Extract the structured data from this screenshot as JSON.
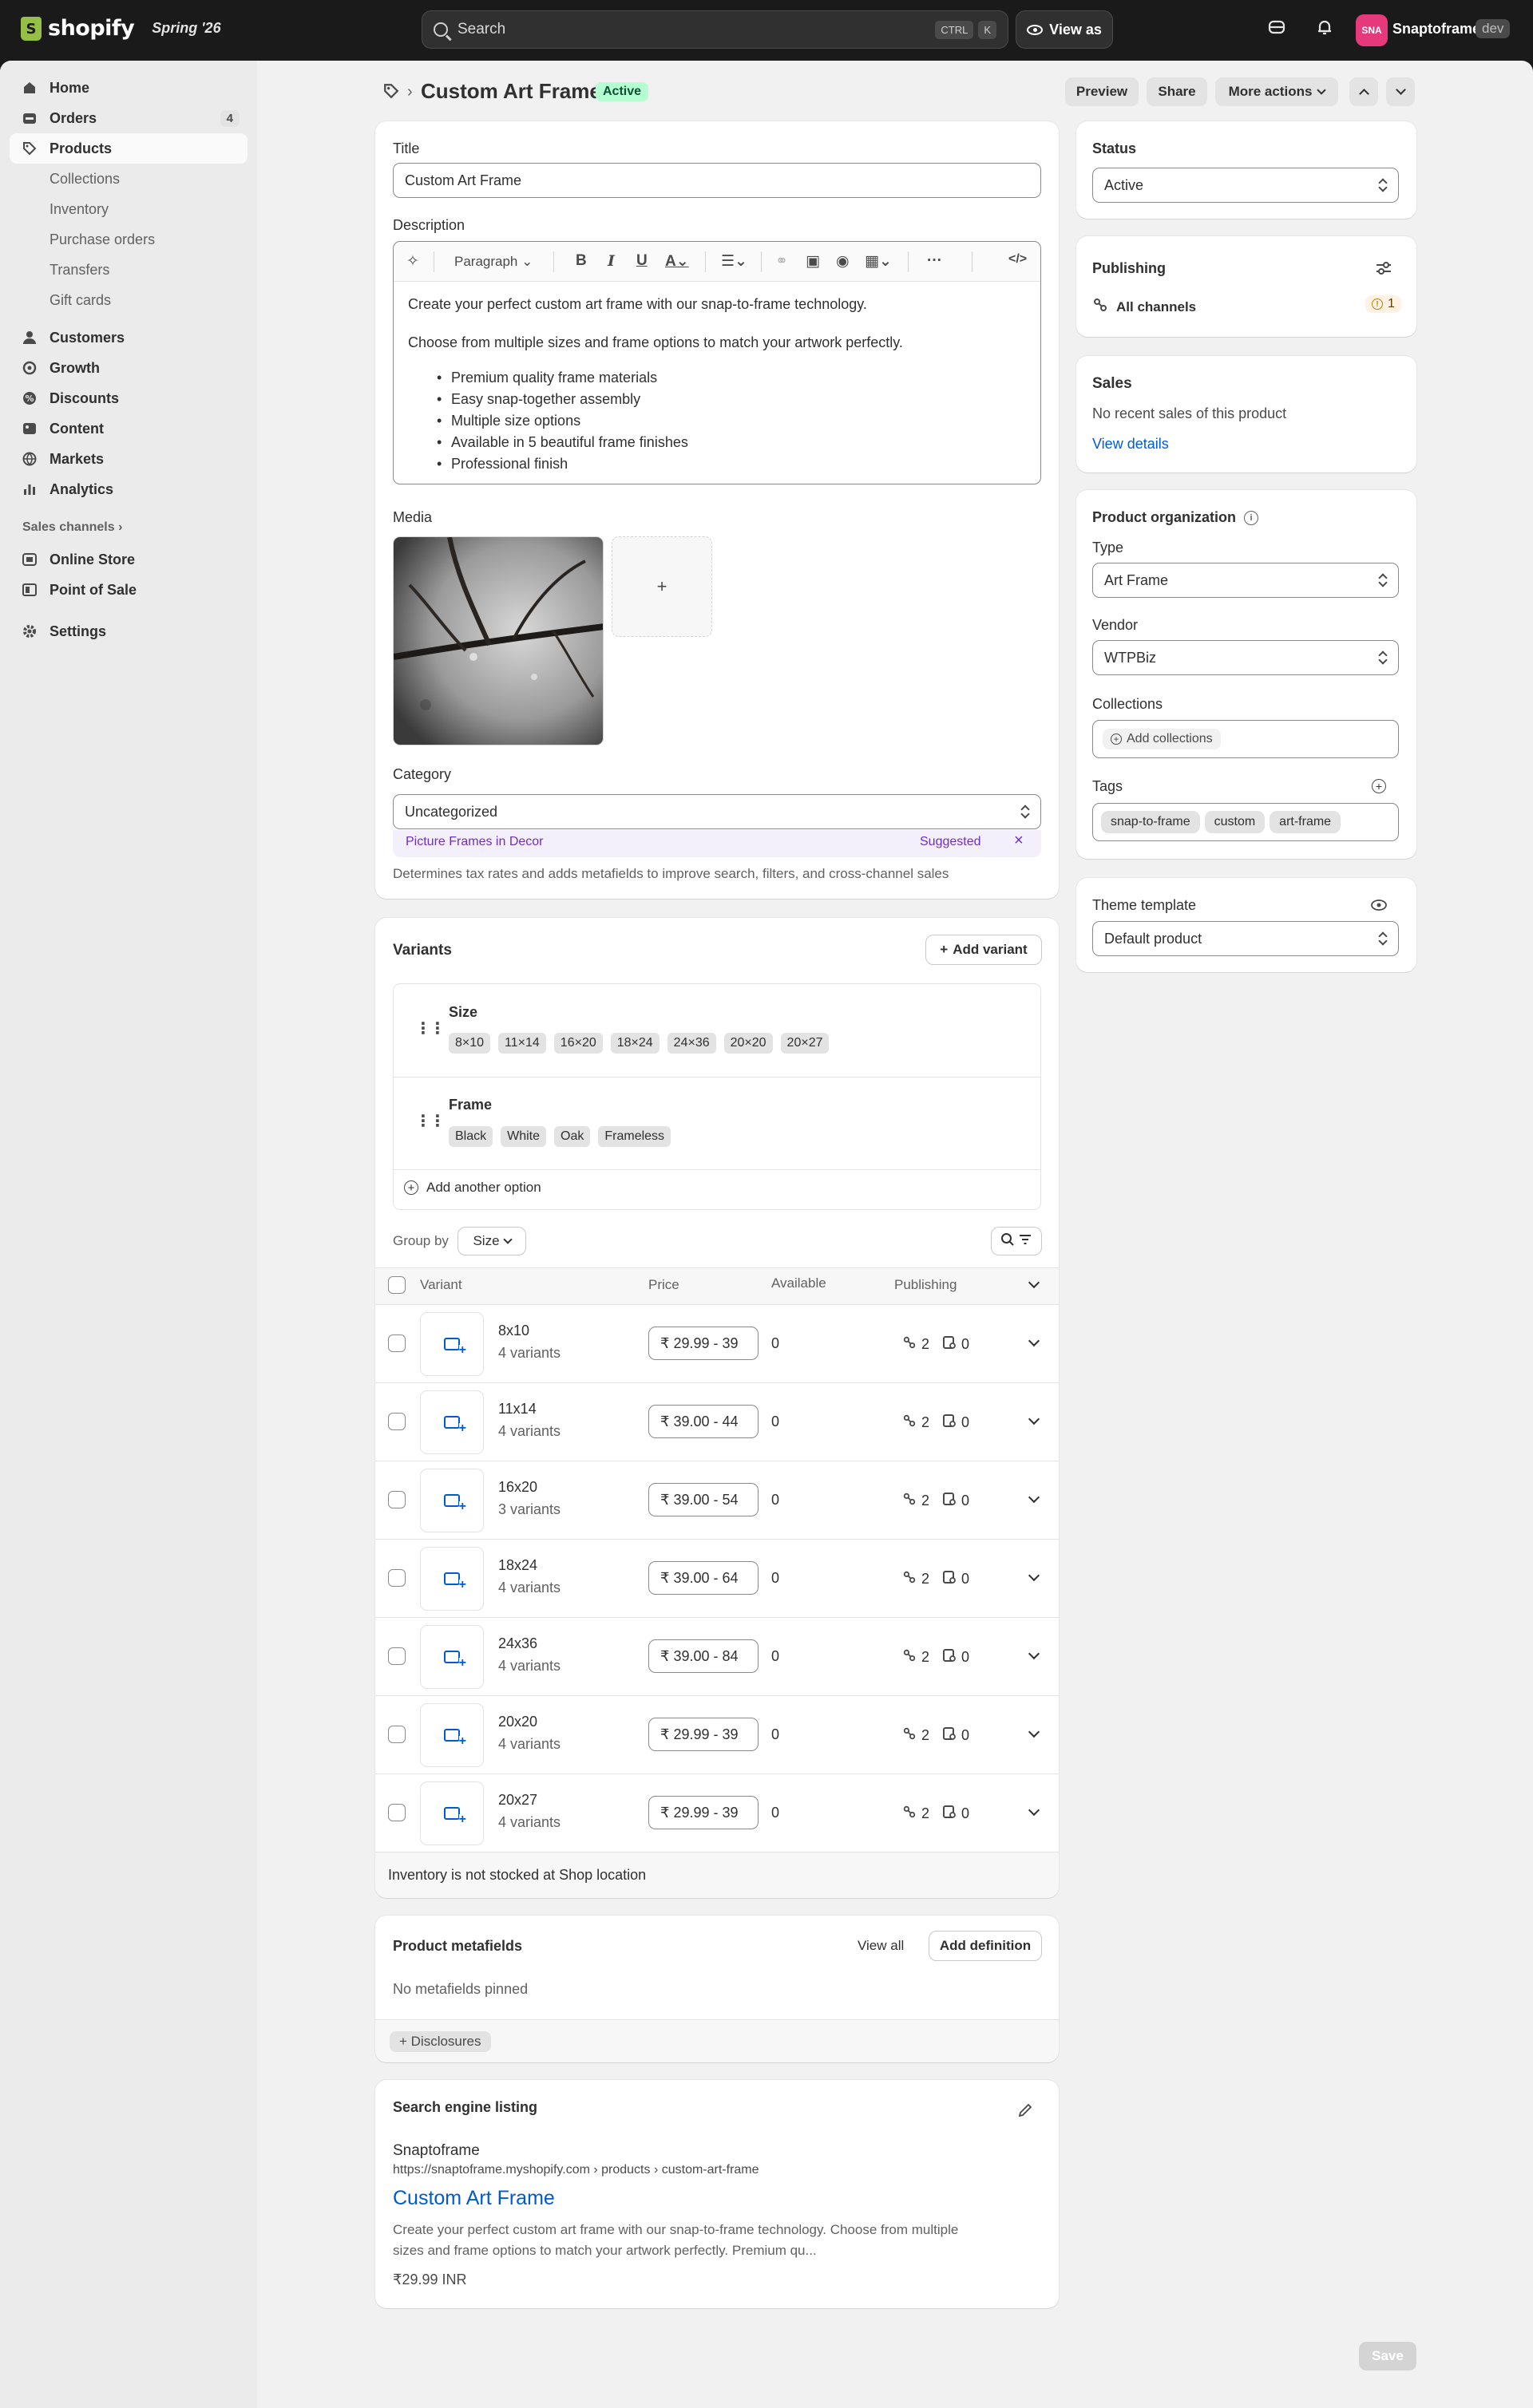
{
  "topbar": {
    "logo_text": "shopify",
    "edition": "Spring '26",
    "search_placeholder": "Search",
    "shortcut_keys": [
      "CTRL",
      "K"
    ],
    "view_as": "View as",
    "store_initials": "SNA",
    "store_name": "Snaptoframe",
    "store_badge": "dev"
  },
  "sidebar": {
    "items": [
      {
        "label": "Home",
        "icon": "home-icon"
      },
      {
        "label": "Orders",
        "icon": "orders-icon",
        "count": "4"
      },
      {
        "label": "Products",
        "icon": "tag-icon",
        "active": true
      },
      {
        "label": "Customers",
        "icon": "person-icon"
      },
      {
        "label": "Growth",
        "icon": "growth-icon"
      },
      {
        "label": "Discounts",
        "icon": "discount-icon"
      },
      {
        "label": "Content",
        "icon": "content-icon"
      },
      {
        "label": "Markets",
        "icon": "globe-icon"
      },
      {
        "label": "Analytics",
        "icon": "chart-icon"
      }
    ],
    "product_subitems": [
      "Collections",
      "Inventory",
      "Purchase orders",
      "Transfers",
      "Gift cards"
    ],
    "sales_channels_label": "Sales channels",
    "channels": [
      {
        "label": "Online Store",
        "icon": "store-icon"
      },
      {
        "label": "Point of Sale",
        "icon": "pos-icon"
      }
    ],
    "settings": "Settings"
  },
  "header": {
    "title": "Custom Art Frame",
    "status_badge": "Active",
    "preview": "Preview",
    "share": "Share",
    "more_actions": "More actions"
  },
  "main": {
    "title_label": "Title",
    "title_value": "Custom Art Frame",
    "description_label": "Description",
    "toolbar_paragraph": "Paragraph",
    "description_p1": "Create your perfect custom art frame with our snap-to-frame technology.",
    "description_p2": "Choose from multiple sizes and frame options to match your artwork perfectly.",
    "description_bullets": [
      "Premium quality frame materials",
      "Easy snap-together assembly",
      "Multiple size options",
      "Available in 5 beautiful frame finishes",
      "Professional finish"
    ],
    "media_label": "Media",
    "category_label": "Category",
    "category_value": "Uncategorized",
    "suggested_category": "Picture Frames in Decor",
    "suggested_label": "Suggested",
    "category_help": "Determines tax rates and adds metafields to improve search, filters, and cross-channel sales"
  },
  "variants": {
    "title": "Variants",
    "add_variant": "Add variant",
    "options": [
      {
        "name": "Size",
        "values": [
          "8×10",
          "11×14",
          "16×20",
          "18×24",
          "24×36",
          "20×20",
          "20×27"
        ]
      },
      {
        "name": "Frame",
        "values": [
          "Black",
          "White",
          "Oak",
          "Frameless"
        ]
      }
    ],
    "add_another_option": "Add another option",
    "group_by_label": "Group by",
    "group_by_value": "Size",
    "columns": [
      "Variant",
      "Price",
      "Available",
      "Publishing"
    ],
    "rows": [
      {
        "name": "8x10",
        "sub": "4 variants",
        "price": "₹  29.99 - 39",
        "available": "0",
        "pub1": "2",
        "pub2": "0"
      },
      {
        "name": "11x14",
        "sub": "4 variants",
        "price": "₹  39.00 - 44",
        "available": "0",
        "pub1": "2",
        "pub2": "0"
      },
      {
        "name": "16x20",
        "sub": "3 variants",
        "price": "₹  39.00 - 54",
        "available": "0",
        "pub1": "2",
        "pub2": "0"
      },
      {
        "name": "18x24",
        "sub": "4 variants",
        "price": "₹  39.00 - 64",
        "available": "0",
        "pub1": "2",
        "pub2": "0"
      },
      {
        "name": "24x36",
        "sub": "4 variants",
        "price": "₹  39.00 - 84",
        "available": "0",
        "pub1": "2",
        "pub2": "0"
      },
      {
        "name": "20x20",
        "sub": "4 variants",
        "price": "₹  29.99 - 39",
        "available": "0",
        "pub1": "2",
        "pub2": "0"
      },
      {
        "name": "20x27",
        "sub": "4 variants",
        "price": "₹  29.99 - 39",
        "available": "0",
        "pub1": "2",
        "pub2": "0"
      }
    ],
    "footer": "Inventory is not stocked at Shop location"
  },
  "metafields": {
    "title": "Product metafields",
    "view_all": "View all",
    "add_definition": "Add definition",
    "empty": "No metafields pinned",
    "disclosures": "+ Disclosures"
  },
  "seo": {
    "title": "Search engine listing",
    "store": "Snaptoframe",
    "url": "https://snaptoframe.myshopify.com › products › custom-art-frame",
    "page_title": "Custom Art Frame",
    "description_line1": "Create your perfect custom art frame with our snap-to-frame technology. Choose from multiple",
    "description_line2": "sizes and frame options to match your artwork perfectly. Premium qu...",
    "price": "₹29.99 INR"
  },
  "right": {
    "status_label": "Status",
    "status_value": "Active",
    "publishing_label": "Publishing",
    "all_channels": "All channels",
    "publishing_alert_count": "1",
    "sales_label": "Sales",
    "sales_empty": "No recent sales of this product",
    "view_details": "View details",
    "org_label": "Product organization",
    "type_label": "Type",
    "type_value": "Art Frame",
    "vendor_label": "Vendor",
    "vendor_value": "WTPBiz",
    "collections_label": "Collections",
    "add_collections": "Add collections",
    "tags_label": "Tags",
    "tags": [
      "snap-to-frame",
      "custom",
      "art-frame"
    ],
    "theme_label": "Theme template",
    "theme_value": "Default product"
  },
  "save": "Save",
  "colors": {
    "accent": "#005bd3",
    "active_badge_bg": "#b4fed2",
    "suggest_purple": "#6e2fc4",
    "topbar": "#1a1a1a"
  }
}
